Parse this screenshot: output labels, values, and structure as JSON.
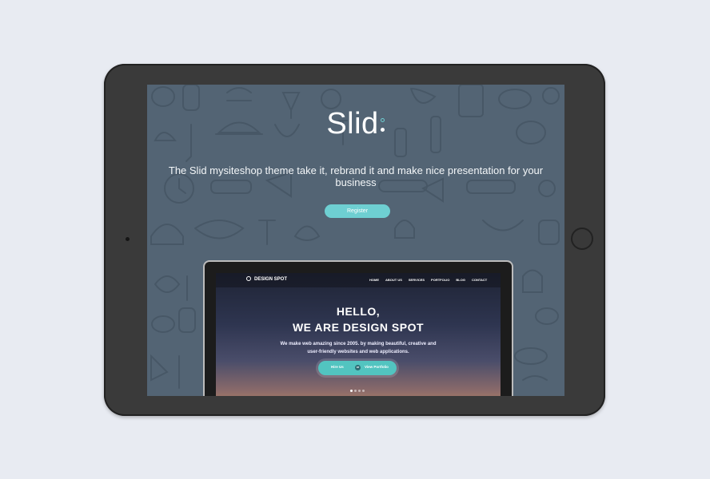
{
  "colors": {
    "background": "#e8ebf2",
    "screen": "#536474",
    "accent": "#6ecfd2",
    "dot_top": "#6ecfd2",
    "dot_bottom": "#ffffff"
  },
  "hero": {
    "logo": "Slid",
    "tagline": "The Slid mysiteshop theme take it, rebrand it and make nice presentation for your business",
    "register_label": "Register"
  },
  "laptop_site": {
    "brand": "DESIGN SPOT",
    "nav": [
      "HOME",
      "ABOUT US",
      "SERVICES",
      "PORTFOLIO",
      "BLOG",
      "CONTACT"
    ],
    "headline_1": "HELLO,",
    "headline_2": "WE ARE DESIGN SPOT",
    "body_1": "We make web amazing since 2005. by making beautiful, creative and",
    "body_2": "user-friendly websites and web applications.",
    "cta_primary": "Hire Us",
    "cta_or": "or",
    "cta_secondary": "View Portfolio"
  },
  "icons": [
    "food-pattern-icon",
    "chef-hat-icon",
    "burger-icon",
    "cake-icon",
    "bottle-icon",
    "fish-icon",
    "cheese-icon",
    "coffee-icon",
    "dish-cover-icon",
    "clock-icon"
  ]
}
